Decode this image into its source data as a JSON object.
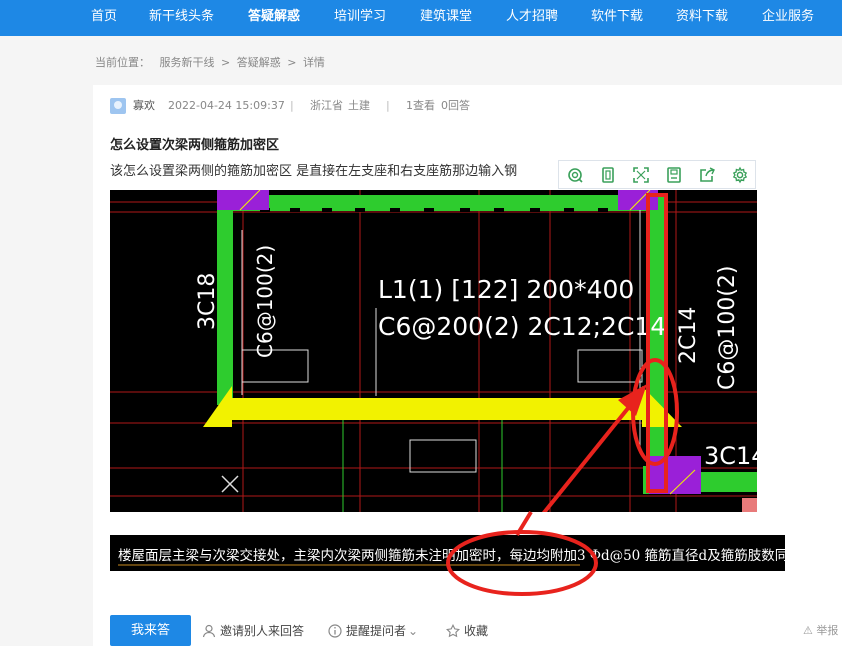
{
  "nav": {
    "items": [
      {
        "label": "首页"
      },
      {
        "label": "新干线头条"
      },
      {
        "label": "答疑解惑",
        "active": true
      },
      {
        "label": "培训学习"
      },
      {
        "label": "建筑课堂"
      },
      {
        "label": "人才招聘"
      },
      {
        "label": "软件下载"
      },
      {
        "label": "资料下载"
      },
      {
        "label": "企业服务"
      }
    ]
  },
  "breadcrumb": {
    "prefix": "当前位置：",
    "items": [
      "服务新干线",
      "答疑解惑",
      "详情"
    ],
    "separator": ">"
  },
  "question": {
    "author": "寡欢",
    "datetime": "2022-04-24 15:09:37",
    "region": "浙江省",
    "category": "土建",
    "views": "1查看",
    "answers": "0回答",
    "title": "怎么设置次梁两侧箍筋加密区",
    "body": "该怎么设置梁两侧的箍筋加密区 是直接在左支座和右支座筋那边输入钢"
  },
  "image_toolbar": {
    "icons": [
      "search-icon",
      "fit-icon",
      "fullscreen-icon",
      "save-icon",
      "share-icon",
      "settings-icon"
    ]
  },
  "cad": {
    "beam_label_1": "L1(1) [122] 200*400",
    "beam_label_2": "C6@200(2) 2C12;2C14",
    "left_rebar": "3C18",
    "left_stirrup": "C6@100(2)",
    "right_rebar": "2C14",
    "right_stirrup": "C6@100(2)",
    "bottom_right": "3C14"
  },
  "note_strip": {
    "text": "楼屋面层主梁与次梁交接处，主梁内次梁两侧箍筋未注明加密时，每边均附加3 Φd@50 箍筋直径d及箍筋肢数同主梁箍。"
  },
  "actions": {
    "answer_button": "我来答",
    "invite": "邀请别人来回答",
    "remind": "提醒提问者",
    "favorite": "收藏",
    "report": "举报"
  },
  "colors": {
    "brand": "#1e88e5",
    "cad_green": "#2ecc2e",
    "cad_yellow": "#f2f200",
    "annotation_red": "#e8231d"
  }
}
